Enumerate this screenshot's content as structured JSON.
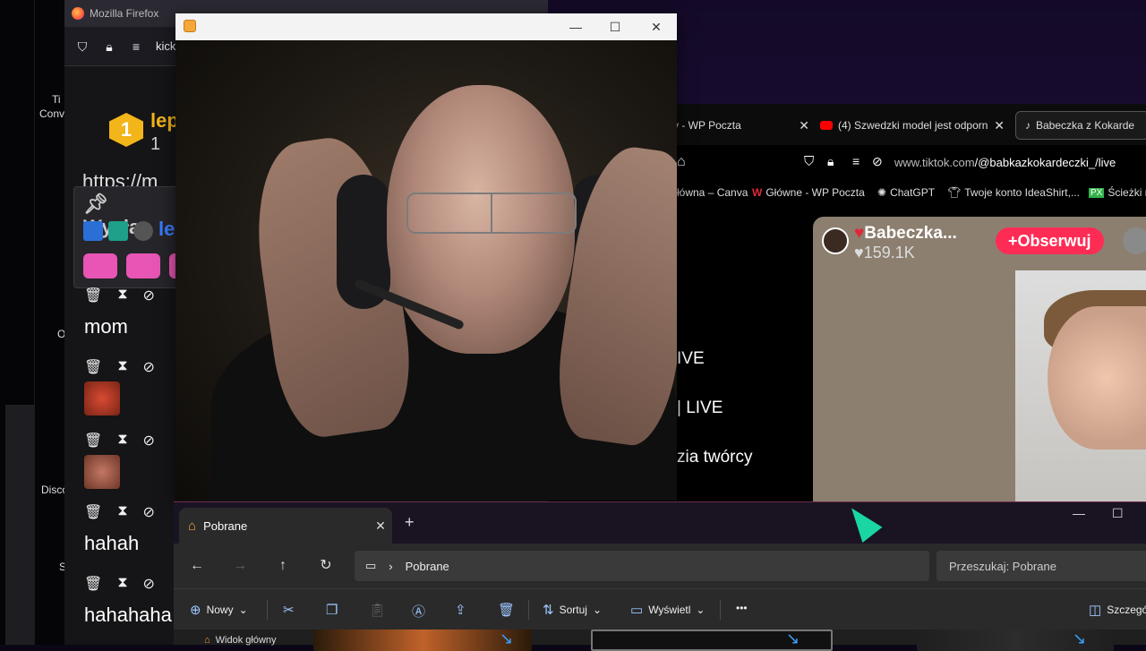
{
  "firefox": {
    "title": "Mozilla Firefox",
    "url": "kick.c"
  },
  "desktop_labels": [
    "Ti",
    "Conv",
    "O",
    "Disco",
    "S"
  ],
  "chat": {
    "rank": "1",
    "user": "lep",
    "count": "1",
    "link": "https://m",
    "pinned_label": "Wysłan",
    "pinned_user": "le",
    "messages": [
      {
        "text": "mom"
      },
      {
        "text": ""
      },
      {
        "text": ""
      },
      {
        "text": "hahah"
      },
      {
        "text": "hahahaha"
      }
    ]
  },
  "video_window": {
    "minimize": "—",
    "maximize": "☐",
    "close": "✕"
  },
  "tiktok": {
    "tabs": [
      {
        "label": "y - WP Poczta",
        "close": "✕"
      },
      {
        "label": "(4) Szwedzki model jest odporn",
        "close": "✕"
      },
      {
        "label": "Babeczka z Kokarde"
      }
    ],
    "url_host": "www.tiktok.com",
    "url_path": "/@babkazkokardeczki_/live",
    "bookmarks": [
      "łówna – Canva",
      "Główne - WP Poczta",
      "ChatGPT",
      "Twoje konto IdeaShirt,...",
      "Ścieżki n"
    ],
    "menu": [
      "IVE",
      "| LIVE",
      "zia twórcy"
    ],
    "live": {
      "name": "Babeczka...",
      "likes": "159.1K",
      "follow": "+Obserwuj"
    }
  },
  "explorer": {
    "tab_label": "Pobrane",
    "tab_close": "✕",
    "new_tab": "+",
    "window_min": "—",
    "window_max": "☐",
    "path_root": "Pobrane",
    "search_placeholder": "Przeszukaj: Pobrane",
    "toolbar": {
      "new": "Nowy",
      "sort": "Sortuj",
      "view": "Wyświetl",
      "more": "•••",
      "details": "Szczegó"
    },
    "sidebar_item": "Widok główny"
  },
  "colors": {
    "accent_kick": "#53fc18",
    "tiktok_red": "#fe2c55",
    "explorer_blue": "#9ec7ff"
  }
}
